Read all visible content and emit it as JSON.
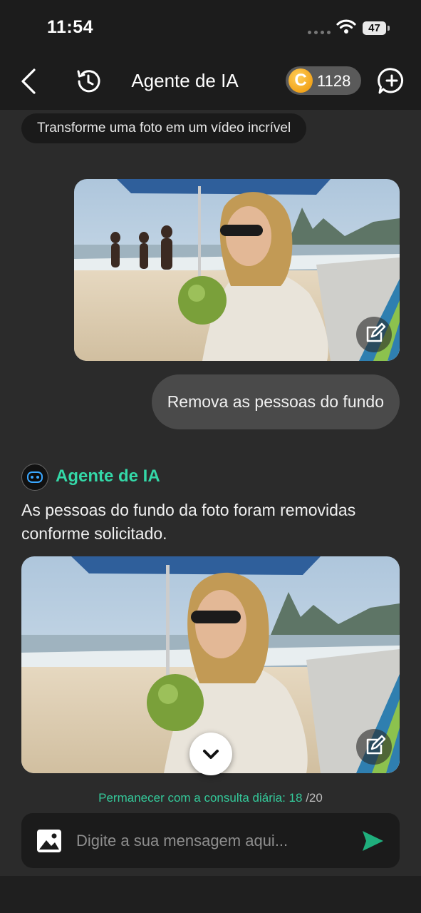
{
  "status_bar": {
    "time": "11:54",
    "battery": "47"
  },
  "header": {
    "title": "Agente de IA",
    "coins": "1128"
  },
  "chat": {
    "prompt_chip": "Transforme uma foto em um vídeo incrível",
    "user_message": "Remova as pessoas do fundo",
    "agent_name": "Agente de IA",
    "agent_reply": "As pessoas do fundo da foto foram removidas conforme solicitado."
  },
  "quota": {
    "label": "Permanecer com a consulta diária: ",
    "used": "18",
    "max": "/20"
  },
  "input": {
    "placeholder": "Digite a sua mensagem aqui..."
  },
  "colors": {
    "accent": "#34d8a8",
    "send": "#1faf7d",
    "coin": "#f2a41b"
  },
  "icons": [
    "back-icon",
    "history-icon",
    "coin-icon",
    "new-chat-icon",
    "edit-icon",
    "chevron-down-icon",
    "image-icon",
    "send-icon"
  ]
}
